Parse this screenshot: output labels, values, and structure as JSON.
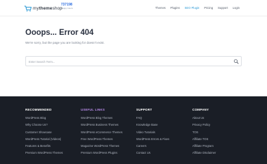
{
  "header": {
    "logo": {
      "prefix": "my",
      "bold": "theme",
      "suffix": "shop"
    },
    "stats": {
      "count": "737198",
      "label": "Happy Users"
    },
    "nav": [
      {
        "label": "Themes"
      },
      {
        "label": "Plugins"
      },
      {
        "label": "SEO Plugin"
      },
      {
        "label": "Pricing"
      },
      {
        "label": "Support"
      },
      {
        "label": "Login"
      }
    ]
  },
  "main": {
    "title": "Ooops... Error 404",
    "subtitle": "We're sorry, but the page you are looking for doesn't exist.",
    "search_placeholder": "Enter Search Term..."
  },
  "footer": {
    "columns": [
      {
        "heading": "RECOMMENDED",
        "items": [
          "WordPress Blog",
          "Why Choose Us?",
          "Customer Showcase",
          "WordPress Tutorial (Videos)",
          "Features & Benefits",
          "Premium WordPress Themes"
        ]
      },
      {
        "heading": "USEFUL LINKS",
        "items": [
          "WordPress Blog Themes",
          "WordPress Business Themes",
          "WordPress eCommerce Themes",
          "Free WordPress Themes",
          "Magazine WordPress Themes",
          "Premium WordPress Plugins"
        ]
      },
      {
        "heading": "SUPPORT",
        "items": [
          "FAQ",
          "Knowledge Base",
          "Video Tutorials",
          "WordPress Errors & Fixes",
          "Careers",
          "Contact Us"
        ]
      },
      {
        "heading": "COMPANY",
        "items": [
          "About Us",
          "Privacy Policy",
          "TOS",
          "Affiliate TOS",
          "Affiliate Program",
          "Affiliate Disclaimer"
        ]
      }
    ]
  },
  "colors": {
    "accent": "#2f9bd6",
    "footer_bg": "#1a1e26",
    "useful_links_heading": "#b68ae6"
  },
  "icons": {
    "logo": "shopping-cart-icon",
    "search": "search-icon"
  }
}
